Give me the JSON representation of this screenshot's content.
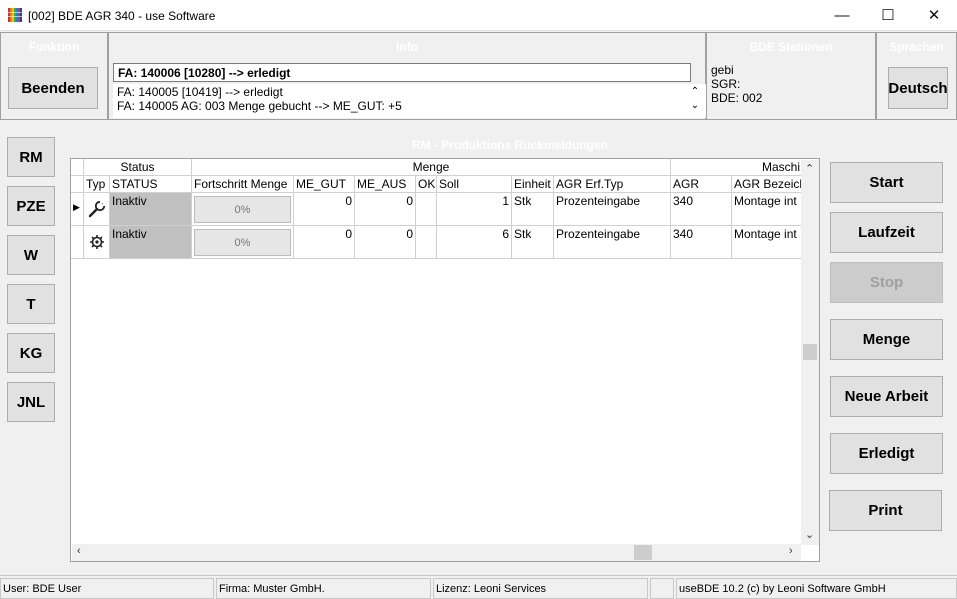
{
  "window": {
    "title": "[002] BDE AGR 340 - use Software"
  },
  "panels": {
    "funktion": {
      "caption": "Funktion",
      "button": "Beenden"
    },
    "info": {
      "caption": "Info",
      "current": "FA: 140006 [10280] --> erledigt",
      "log": [
        "FA: 140005 [10419] --> erledigt",
        "FA: 140005 AG: 003 Menge gebucht --> ME_GUT: +5"
      ]
    },
    "station": {
      "caption": "BDE Stationen",
      "lines": [
        "gebi",
        "SGR:",
        "BDE: 002"
      ]
    },
    "sprachen": {
      "caption": "Sprachen",
      "button": "Deutsch"
    }
  },
  "nav": [
    "RM",
    "PZE",
    "W",
    "T",
    "KG",
    "JNL"
  ],
  "rm_caption": "RM - Produktions Rückmeldungen",
  "grid": {
    "groups": [
      "Status",
      "Menge",
      "Maschi"
    ],
    "columns": [
      "Typ",
      "STATUS",
      "Fortschritt Menge",
      "ME_GUT",
      "ME_AUS",
      "OK",
      "Soll",
      "Einheit",
      "AGR Erf.Typ",
      "AGR",
      "AGR Bezeich"
    ],
    "rows": [
      {
        "icon": "wrench-icon",
        "status": "Inaktiv",
        "progress": "0%",
        "me_gut": "0",
        "me_aus": "0",
        "ok": "",
        "soll": "1",
        "einheit": "Stk",
        "erf_typ": "Prozenteingabe",
        "agr": "340",
        "bezeich": "Montage int"
      },
      {
        "icon": "gear-icon",
        "status": "Inaktiv",
        "progress": "0%",
        "me_gut": "0",
        "me_aus": "0",
        "ok": "",
        "soll": "6",
        "einheit": "Stk",
        "erf_typ": "Prozenteingabe",
        "agr": "340",
        "bezeich": "Montage int"
      }
    ]
  },
  "actions": [
    {
      "label": "Start",
      "enabled": true
    },
    {
      "label": "Laufzeit",
      "enabled": true
    },
    {
      "label": "Stop",
      "enabled": false
    },
    {
      "label": "Menge",
      "enabled": true
    },
    {
      "label": "Neue Arbeit",
      "enabled": true
    },
    {
      "label": "Erledigt",
      "enabled": true
    },
    {
      "label": "Print",
      "enabled": true
    }
  ],
  "statusbar": {
    "user": "User: BDE User",
    "firma": "Firma: Muster GmbH.",
    "lizenz": "Lizenz: Leoni Services",
    "empty": "",
    "version": "useBDE 10.2 (c) by Leoni Software GmbH"
  }
}
